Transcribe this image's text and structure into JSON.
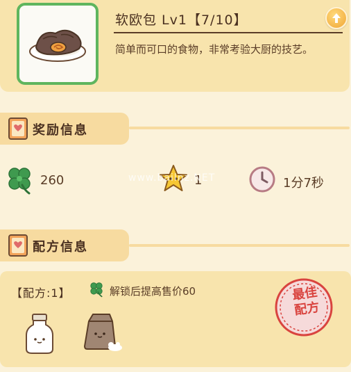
{
  "item": {
    "title": "软欧包 Lv1【7/10】",
    "description": "简单而可口的食物，非常考验大厨的技艺。"
  },
  "sections": {
    "reward_label": "奖励信息",
    "recipe_label": "配方信息"
  },
  "rewards": {
    "clover_value": "260",
    "star_value": "1",
    "time_value": "1分7秒"
  },
  "recipe": {
    "title": "【配方:1】",
    "bonus": "解锁后提高售价60",
    "stamp_line1": "最佳",
    "stamp_line2": "配方",
    "ingredients": [
      "milk-bottle",
      "flour-bag"
    ]
  },
  "watermark": "www.bailnz.NET",
  "colors": {
    "clover": "#3f9a4f",
    "star": "#f6c733",
    "stamp": "#d9443f",
    "thumb_border": "#5fb55e",
    "card_bg": "#f8e4ad"
  },
  "icons": [
    "upgrade-arrow-icon",
    "book-icon",
    "clover-icon",
    "star-icon",
    "clock-icon",
    "stamp-icon"
  ]
}
